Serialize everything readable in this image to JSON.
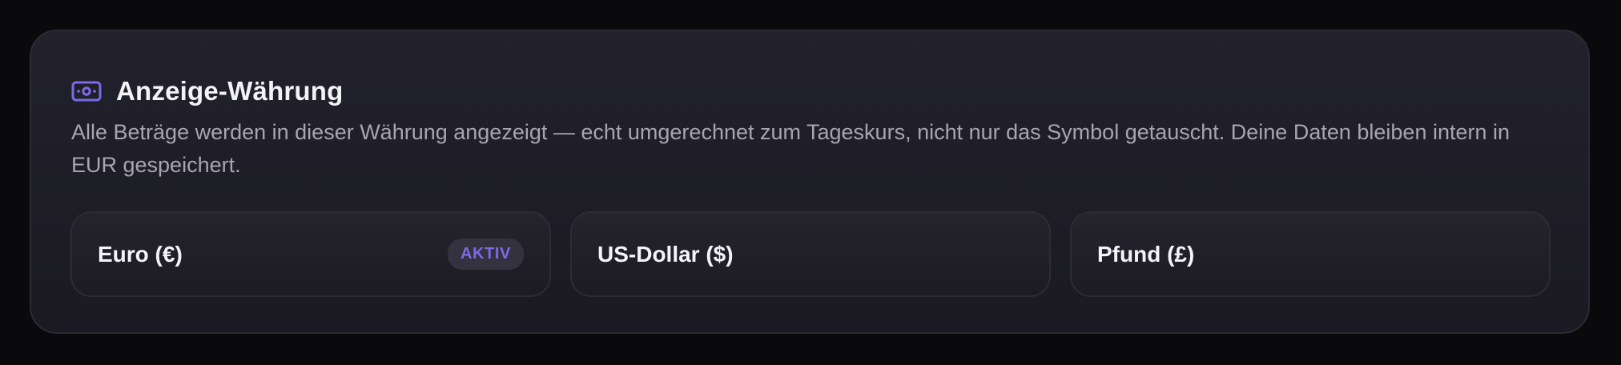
{
  "section": {
    "title": "Anzeige-Währung",
    "icon": "banknote-icon",
    "accent_color": "#7d6ae6",
    "description": "Alle Beträge werden in dieser Währung angezeigt — echt umgerechnet zum Tageskurs, nicht nur das Symbol getauscht. Deine Daten bleiben intern in EUR gespeichert."
  },
  "options": [
    {
      "label": "Euro (€)",
      "badge": "AKTIV",
      "active": true
    },
    {
      "label": "US-Dollar ($)",
      "active": false
    },
    {
      "label": "Pfund (£)",
      "active": false
    }
  ]
}
